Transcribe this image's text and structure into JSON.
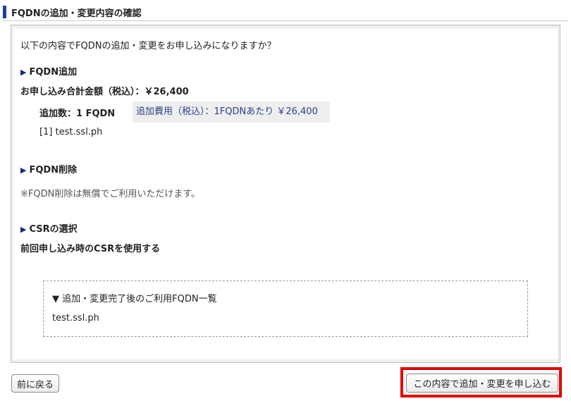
{
  "header": {
    "title": "FQDNの追加・変更内容の確認"
  },
  "confirm": {
    "question": "以下の内容でFQDNの追加・変更をお申し込みになりますか？",
    "add_section": {
      "heading": "FQDN追加",
      "total_label": "お申し込み合計金額（税込）：￥26,400",
      "count_label": "追加数：1 FQDN",
      "fee_label": "追加費用（税込）：1FQDNあたり ￥26,400",
      "items": [
        "[1] test.ssl.ph"
      ]
    },
    "delete_section": {
      "heading": "FQDN削除",
      "note": "※FQDN削除は無償でご利用いただけます。"
    },
    "csr_section": {
      "heading": "CSRの選択",
      "value": "前回申し込み時のCSRを使用する"
    },
    "fqdn_list": {
      "heading": "▼ 追加・変更完了後のご利用FQDN一覧",
      "items": [
        "test.ssl.ph"
      ]
    }
  },
  "footer": {
    "back_label": "前に戻る",
    "submit_label": "この内容で追加・変更を申し込む"
  },
  "colors": {
    "accent": "#1f3f9e",
    "fee_text": "#2b3f8c",
    "highlight": "#e00000"
  }
}
